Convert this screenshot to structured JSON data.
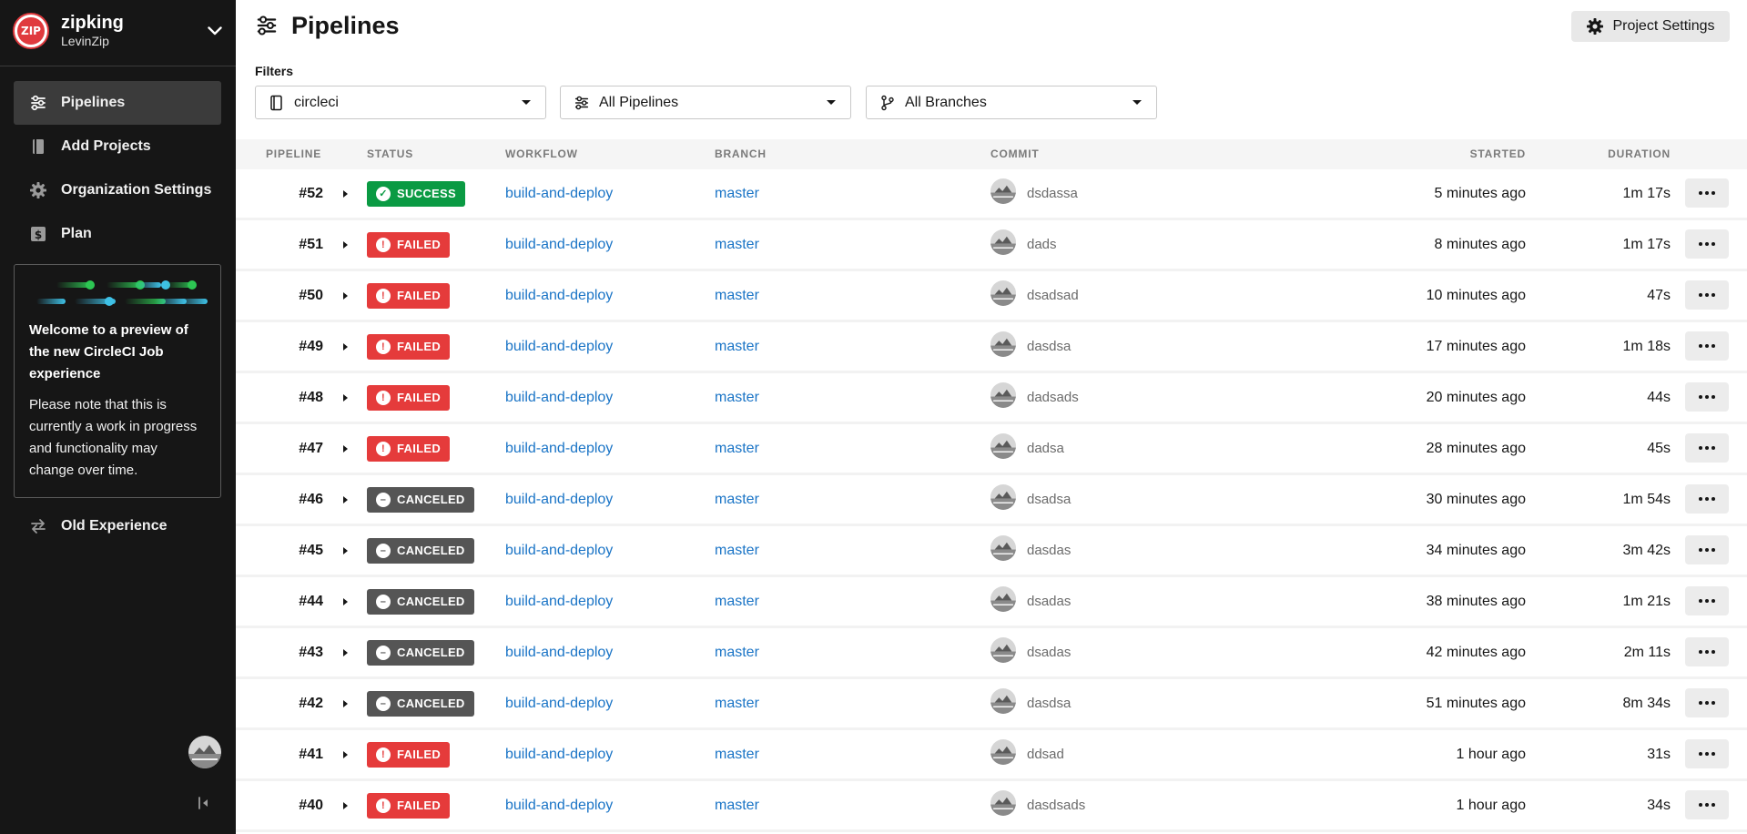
{
  "org": {
    "name": "zipking",
    "subtitle": "LevinZip",
    "logo_text": "ZIP"
  },
  "nav": {
    "items": [
      {
        "label": "Pipelines",
        "icon": "pipelines-icon",
        "active": true
      },
      {
        "label": "Add Projects",
        "icon": "book-icon",
        "active": false
      },
      {
        "label": "Organization Settings",
        "icon": "gear-icon",
        "active": false
      },
      {
        "label": "Plan",
        "icon": "dollar-icon",
        "active": false
      }
    ],
    "old_experience": "Old Experience"
  },
  "preview": {
    "title": "Welcome to a preview of the new CircleCI Job experience",
    "body": "Please note that this is currently a work in progress and functionality may change over time."
  },
  "page": {
    "title": "Pipelines",
    "settings_button": "Project Settings"
  },
  "filters": {
    "label": "Filters",
    "project": "circleci",
    "pipelines": "All Pipelines",
    "branches": "All Branches"
  },
  "table": {
    "headers": {
      "pipeline": "PIPELINE",
      "status": "STATUS",
      "workflow": "WORKFLOW",
      "branch": "BRANCH",
      "commit": "COMMIT",
      "started": "STARTED",
      "duration": "DURATION"
    },
    "rows": [
      {
        "number": "#52",
        "status": "SUCCESS",
        "workflow": "build-and-deploy",
        "branch": "master",
        "commit": "dsdassa",
        "started": "5 minutes ago",
        "duration": "1m 17s"
      },
      {
        "number": "#51",
        "status": "FAILED",
        "workflow": "build-and-deploy",
        "branch": "master",
        "commit": "dads",
        "started": "8 minutes ago",
        "duration": "1m 17s"
      },
      {
        "number": "#50",
        "status": "FAILED",
        "workflow": "build-and-deploy",
        "branch": "master",
        "commit": "dsadsad",
        "started": "10 minutes ago",
        "duration": "47s"
      },
      {
        "number": "#49",
        "status": "FAILED",
        "workflow": "build-and-deploy",
        "branch": "master",
        "commit": "dasdsa",
        "started": "17 minutes ago",
        "duration": "1m 18s"
      },
      {
        "number": "#48",
        "status": "FAILED",
        "workflow": "build-and-deploy",
        "branch": "master",
        "commit": "dadsads",
        "started": "20 minutes ago",
        "duration": "44s"
      },
      {
        "number": "#47",
        "status": "FAILED",
        "workflow": "build-and-deploy",
        "branch": "master",
        "commit": "dadsa",
        "started": "28 minutes ago",
        "duration": "45s"
      },
      {
        "number": "#46",
        "status": "CANCELED",
        "workflow": "build-and-deploy",
        "branch": "master",
        "commit": "dsadsa",
        "started": "30 minutes ago",
        "duration": "1m 54s"
      },
      {
        "number": "#45",
        "status": "CANCELED",
        "workflow": "build-and-deploy",
        "branch": "master",
        "commit": "dasdas",
        "started": "34 minutes ago",
        "duration": "3m 42s"
      },
      {
        "number": "#44",
        "status": "CANCELED",
        "workflow": "build-and-deploy",
        "branch": "master",
        "commit": "dsadas",
        "started": "38 minutes ago",
        "duration": "1m 21s"
      },
      {
        "number": "#43",
        "status": "CANCELED",
        "workflow": "build-and-deploy",
        "branch": "master",
        "commit": "dsadas",
        "started": "42 minutes ago",
        "duration": "2m 11s"
      },
      {
        "number": "#42",
        "status": "CANCELED",
        "workflow": "build-and-deploy",
        "branch": "master",
        "commit": "dasdsa",
        "started": "51 minutes ago",
        "duration": "8m 34s"
      },
      {
        "number": "#41",
        "status": "FAILED",
        "workflow": "build-and-deploy",
        "branch": "master",
        "commit": "ddsad",
        "started": "1 hour ago",
        "duration": "31s"
      },
      {
        "number": "#40",
        "status": "FAILED",
        "workflow": "build-and-deploy",
        "branch": "master",
        "commit": "dasdsads",
        "started": "1 hour ago",
        "duration": "34s"
      }
    ]
  },
  "colors": {
    "sidebar_bg": "#161616",
    "success": "#0a9a43",
    "failed": "#e53b3b",
    "canceled": "#555555",
    "link": "#1a74c6",
    "accent_green": "#2dc653",
    "accent_blue": "#3ec1e6"
  }
}
